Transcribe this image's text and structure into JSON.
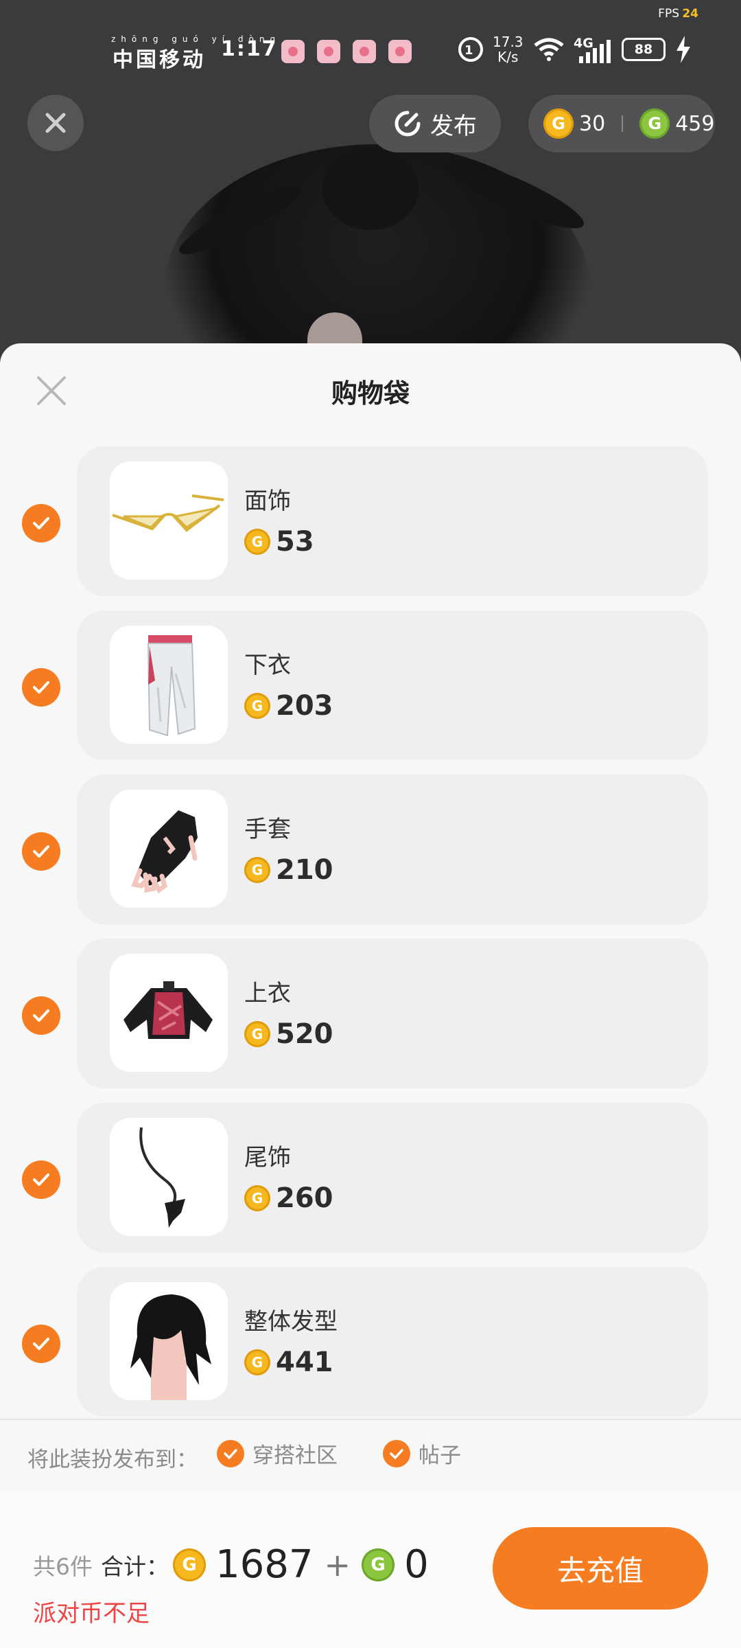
{
  "status_bar": {
    "fps_label": "FPS",
    "fps_value": "24",
    "carrier": "中国移动",
    "carrier_pinyin": "zhōng guó yí dòng",
    "time": "1:17",
    "net_speed_value": "17.3",
    "net_speed_unit": "K/s",
    "signal_label": "4G",
    "battery_level": "88"
  },
  "top_bar": {
    "publish_label": "发布",
    "gold_coins": "30",
    "green_coins": "459"
  },
  "sheet": {
    "title": "购物袋",
    "items": [
      {
        "name": "面饰",
        "price": "53",
        "checked": true
      },
      {
        "name": "下衣",
        "price": "203",
        "checked": true
      },
      {
        "name": "手套",
        "price": "210",
        "checked": true
      },
      {
        "name": "上衣",
        "price": "520",
        "checked": true
      },
      {
        "name": "尾饰",
        "price": "260",
        "checked": true
      },
      {
        "name": "整体发型",
        "price": "441",
        "checked": true
      }
    ],
    "publish_to_label": "将此装扮发布到：",
    "publish_options": [
      {
        "label": "穿搭社区",
        "checked": true
      },
      {
        "label": "帖子",
        "checked": true
      }
    ]
  },
  "footer": {
    "count_text": "共6件",
    "total_label": "合计：",
    "gold_total": "1687",
    "plus": "+",
    "green_total": "0",
    "warning": "派对币不足",
    "recharge_label": "去充值"
  },
  "colors": {
    "accent": "#f57c20",
    "gold_coin": "#f5b81f",
    "green_coin": "#8cc63f",
    "warning": "#ee4444"
  }
}
